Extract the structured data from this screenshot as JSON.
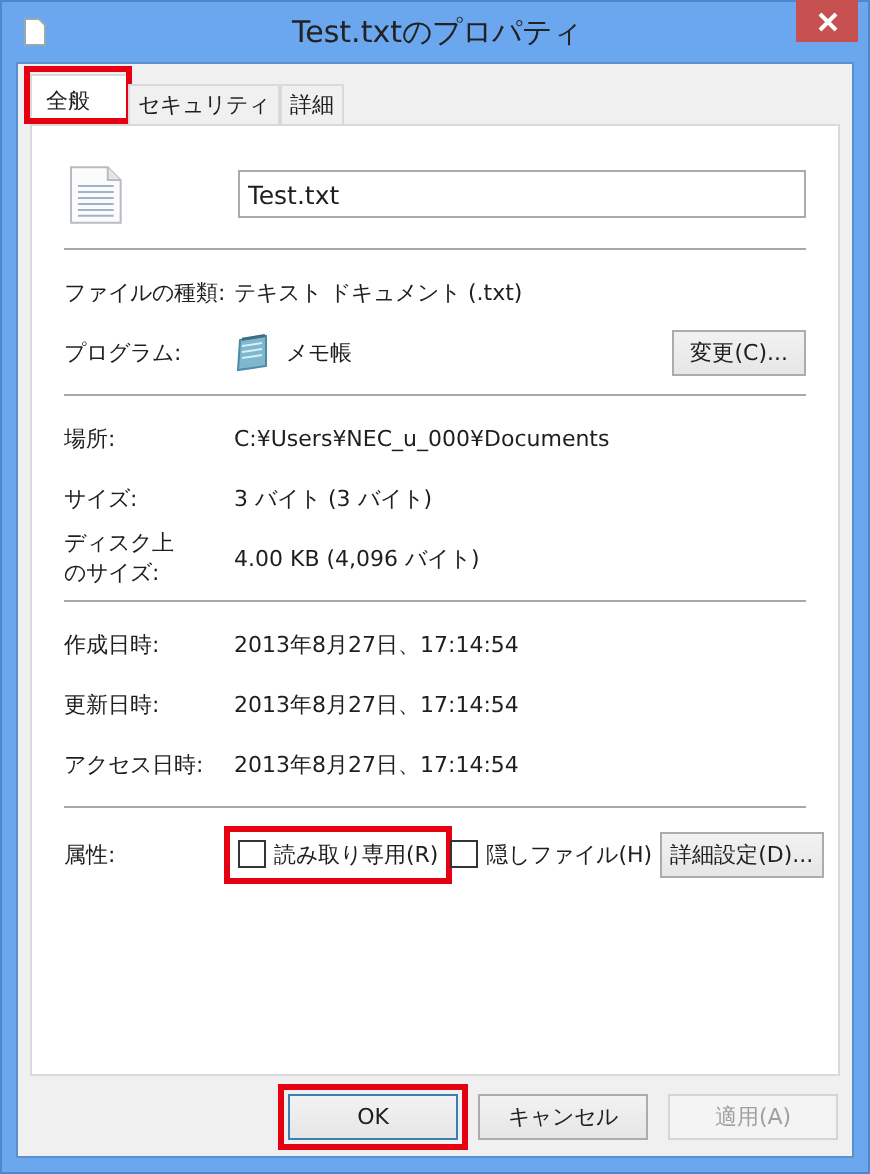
{
  "window": {
    "title": "Test.txtのプロパティ"
  },
  "tabs": [
    {
      "label": "全般",
      "selected": true,
      "highlighted": true
    },
    {
      "label": "セキュリティ",
      "selected": false,
      "highlighted": false
    },
    {
      "label": "詳細",
      "selected": false,
      "highlighted": false
    }
  ],
  "general": {
    "file_name": "Test.txt",
    "sections": [
      [
        {
          "kind": "text",
          "label": "ファイルの種類:",
          "value": "テキスト ドキュメント (.txt)"
        },
        {
          "kind": "program",
          "label": "プログラム:",
          "value": "メモ帳",
          "button": "変更(C)..."
        }
      ],
      [
        {
          "kind": "text",
          "label": "場所:",
          "value": "C:¥Users¥NEC_u_000¥Documents"
        },
        {
          "kind": "text",
          "label": "サイズ:",
          "value": "3 バイト (3 バイト)"
        },
        {
          "kind": "text",
          "label_lines": [
            "ディスク上",
            "のサイズ:"
          ],
          "value": "4.00 KB (4,096 バイト)"
        }
      ],
      [
        {
          "kind": "text",
          "label": "作成日時:",
          "value": "2013年8月27日、17:14:54"
        },
        {
          "kind": "text",
          "label": "更新日時:",
          "value": "2013年8月27日、17:14:54"
        },
        {
          "kind": "text",
          "label": "アクセス日時:",
          "value": "2013年8月27日、17:14:54"
        }
      ]
    ],
    "attributes": {
      "label": "属性:",
      "options": [
        {
          "label": "読み取り専用(R)",
          "checked": false,
          "highlighted": true
        },
        {
          "label": "隠しファイル(H)",
          "checked": false,
          "highlighted": false
        }
      ],
      "button": "詳細設定(D)..."
    }
  },
  "buttons": [
    {
      "label": "OK",
      "default": true,
      "disabled": false,
      "highlighted": true
    },
    {
      "label": "キャンセル",
      "default": false,
      "disabled": false,
      "highlighted": false
    },
    {
      "label": "適用(A)",
      "default": false,
      "disabled": true,
      "highlighted": false
    }
  ]
}
